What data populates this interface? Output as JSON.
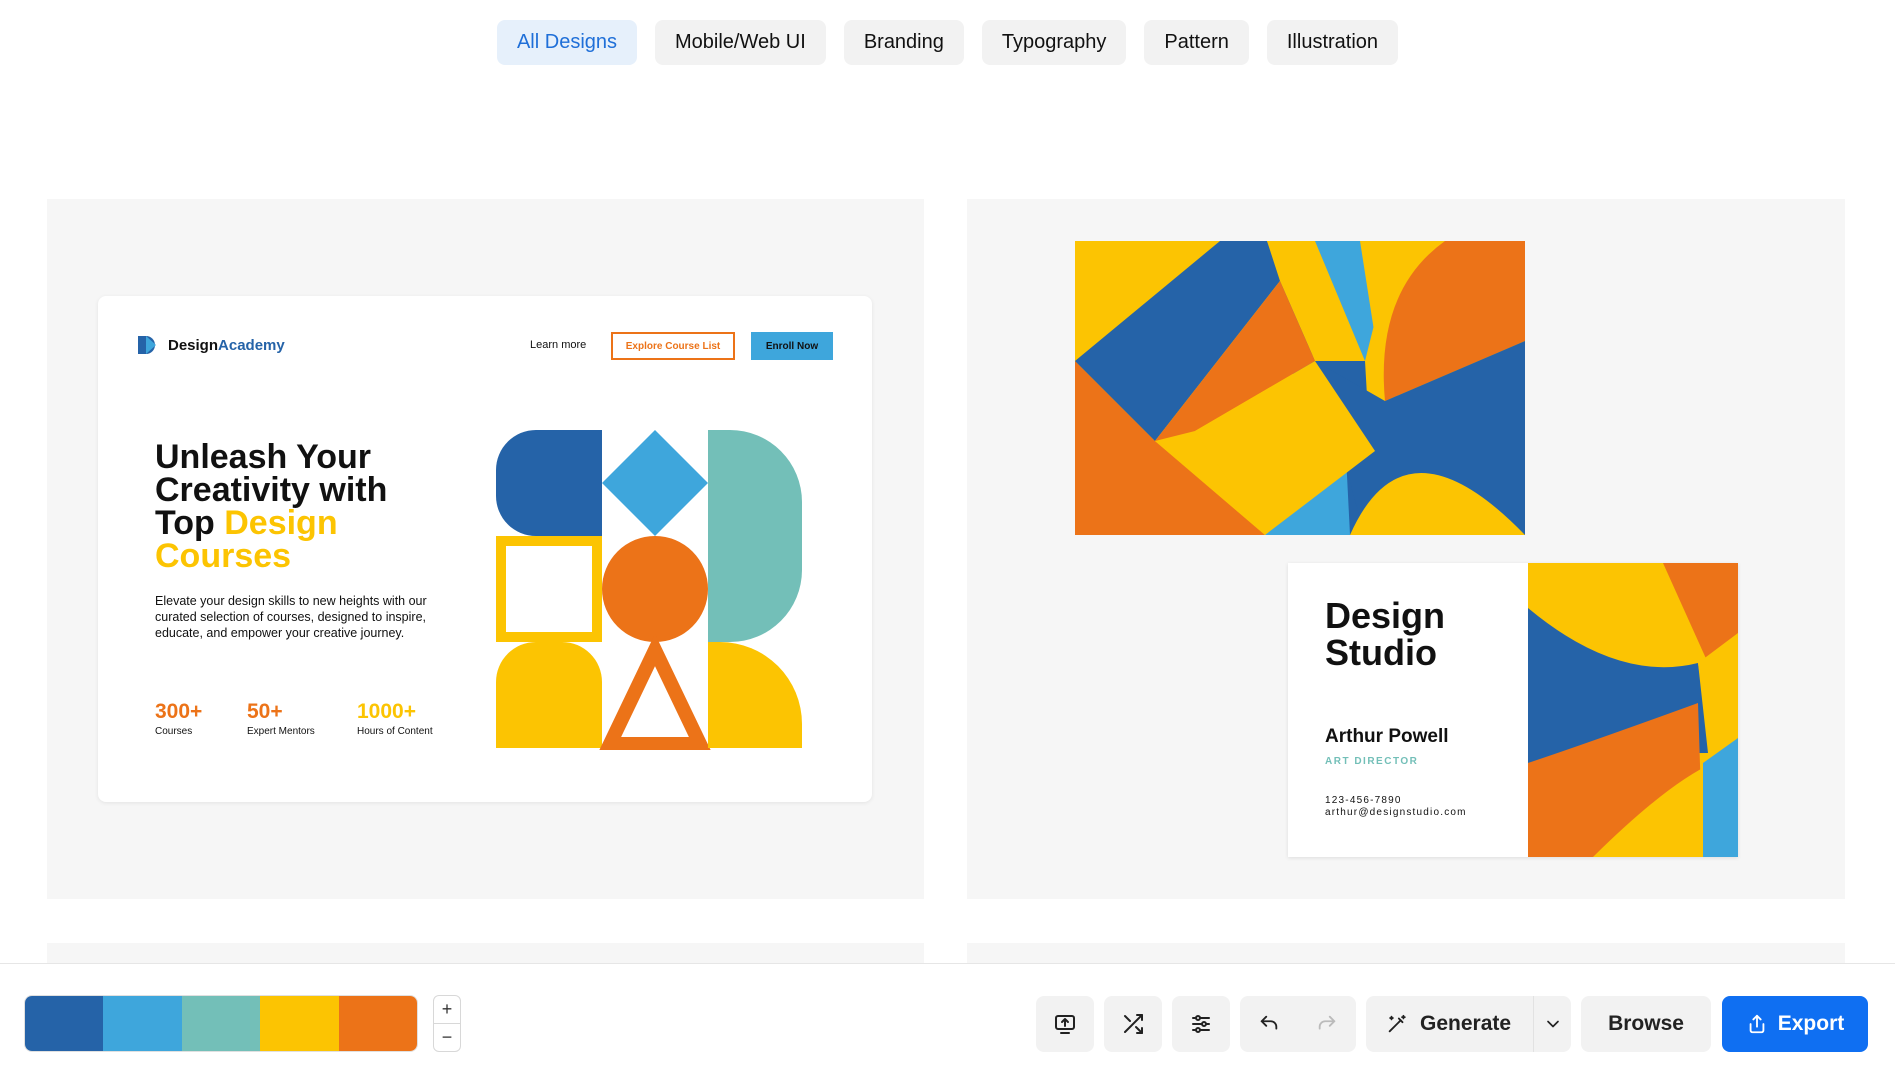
{
  "tabs": [
    {
      "label": "All Designs",
      "active": true
    },
    {
      "label": "Mobile/Web UI",
      "active": false
    },
    {
      "label": "Branding",
      "active": false
    },
    {
      "label": "Typography",
      "active": false
    },
    {
      "label": "Pattern",
      "active": false
    },
    {
      "label": "Illustration",
      "active": false
    }
  ],
  "landing": {
    "logo_part1": "Design",
    "logo_part2": "Academy",
    "nav_learn_more": "Learn more",
    "btn_explore": "Explore Course List",
    "btn_enroll": "Enroll Now",
    "headline_line1": "Unleash Your",
    "headline_line2": "Creativity with",
    "headline_line3a": "Top ",
    "headline_line3b": "Design",
    "headline_line4": "Courses",
    "description": "Elevate your design skills to new heights with our curated selection of courses, designed to inspire, educate, and empower your creative journey.",
    "stats": [
      {
        "num": "300+",
        "label": "Courses",
        "color": "#ec7318"
      },
      {
        "num": "50+",
        "label": "Expert Mentors",
        "color": "#ec7318"
      },
      {
        "num": "1000+",
        "label": "Hours of Content",
        "color": "#fcc402"
      }
    ]
  },
  "business_card": {
    "title_line1": "Design",
    "title_line2": "Studio",
    "name": "Arthur Powell",
    "role": "ART DIRECTOR",
    "phone": "123-456-7890",
    "email": "arthur@designstudio.com"
  },
  "palette": {
    "colors": [
      "#2563a8",
      "#3ea6dc",
      "#73bfb8",
      "#fcc402",
      "#ec7318"
    ]
  },
  "toolbar": {
    "zoom_in": "+",
    "zoom_out": "−",
    "generate_label": "Generate",
    "browse_label": "Browse",
    "export_label": "Export"
  }
}
